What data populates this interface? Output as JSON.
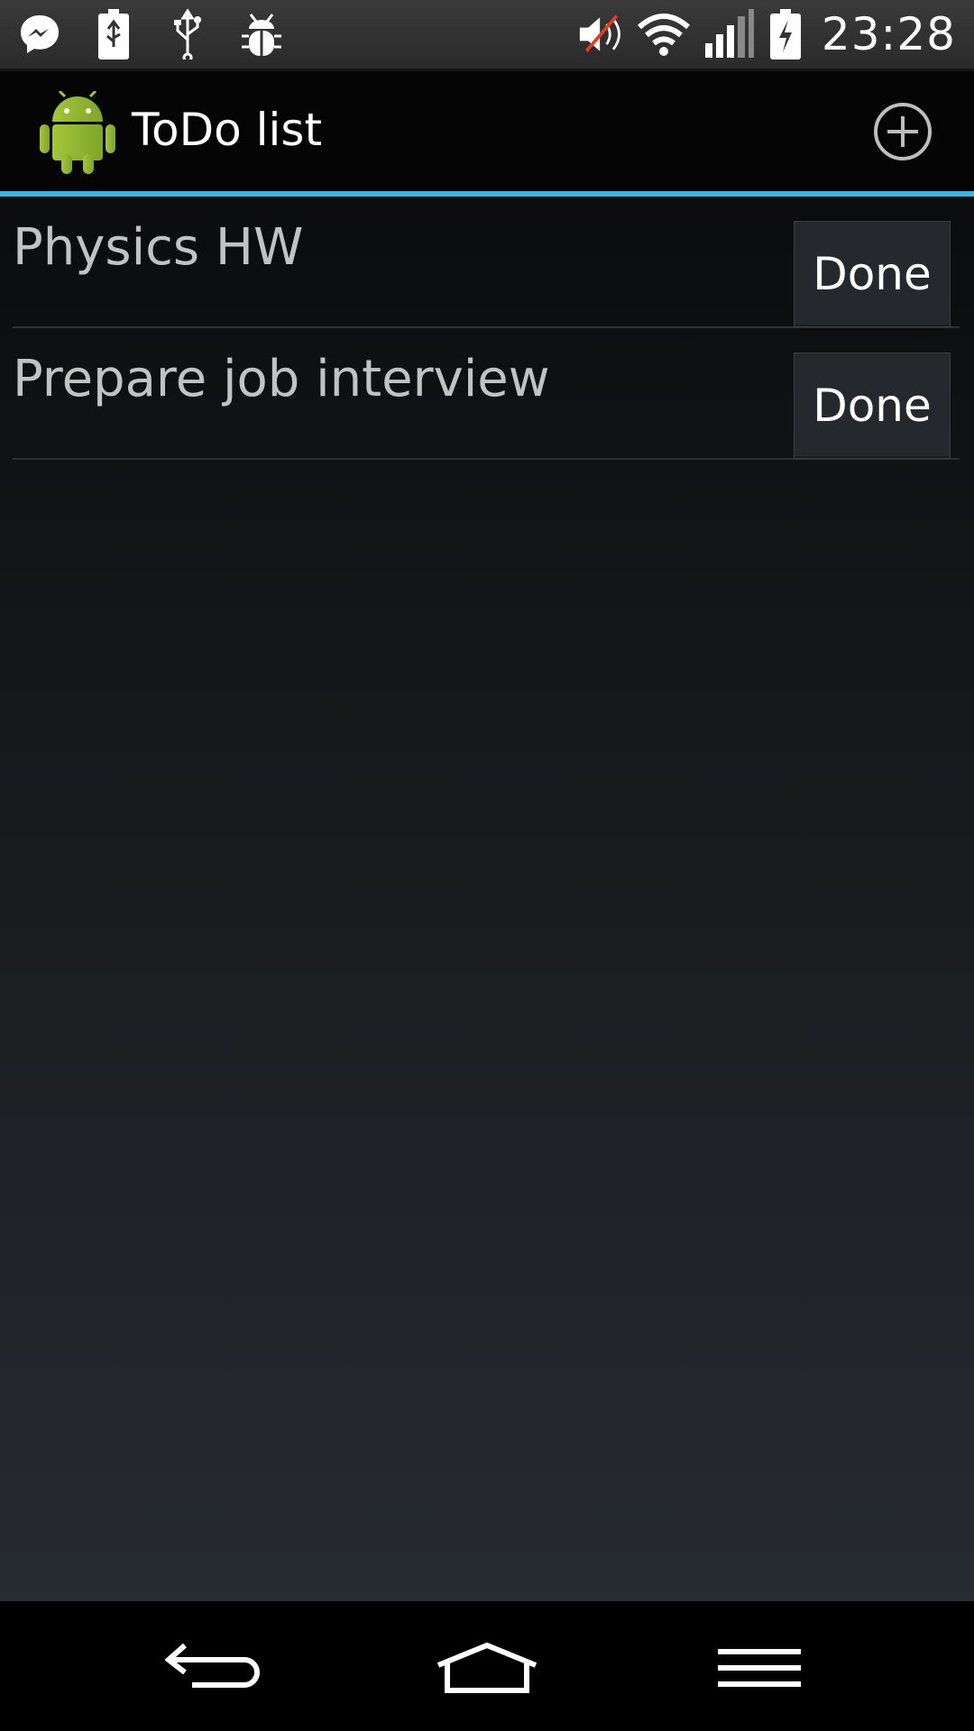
{
  "status_bar": {
    "time": "23:28",
    "left_icons": [
      "messenger-icon",
      "battery-usb-icon",
      "usb-icon",
      "debug-icon"
    ],
    "right_icons": [
      "mute-icon",
      "wifi-icon",
      "signal-icon",
      "battery-charging-icon"
    ]
  },
  "action_bar": {
    "title": "ToDo list",
    "add_icon": "add-circle-icon",
    "accent_color": "#33b5e5"
  },
  "tasks": [
    {
      "label": "Physics HW",
      "button": "Done"
    },
    {
      "label": "Prepare job interview",
      "button": "Done"
    }
  ],
  "nav_bar": {
    "buttons": [
      "back-icon",
      "home-icon",
      "menu-icon"
    ]
  }
}
